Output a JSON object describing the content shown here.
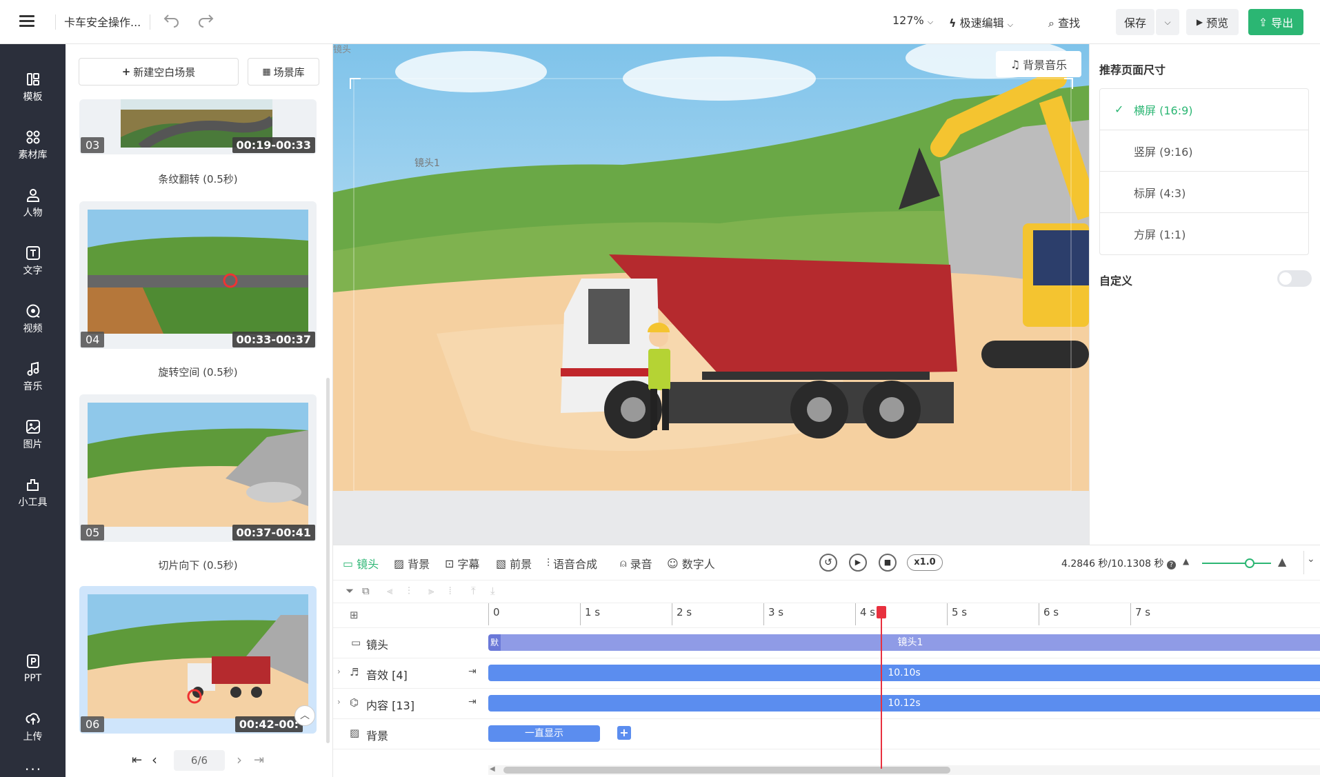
{
  "app": {
    "title": "卡车安全操作...",
    "zoom": "127%",
    "mode": "极速编辑",
    "find": "查找",
    "save": "保存",
    "preview": "预览",
    "export": "导出"
  },
  "nav": [
    {
      "label": "模板",
      "icon": "template-icon"
    },
    {
      "label": "素材库",
      "icon": "assets-icon"
    },
    {
      "label": "人物",
      "icon": "person-icon"
    },
    {
      "label": "文字",
      "icon": "text-icon"
    },
    {
      "label": "视频",
      "icon": "video-icon"
    },
    {
      "label": "音乐",
      "icon": "music-icon"
    },
    {
      "label": "图片",
      "icon": "image-icon"
    },
    {
      "label": "小工具",
      "icon": "tools-icon"
    },
    {
      "label": "PPT",
      "icon": "ppt-icon"
    },
    {
      "label": "上传",
      "icon": "upload-icon"
    }
  ],
  "scenes": {
    "new_blank": "新建空白场景",
    "library": "场景库",
    "items": [
      {
        "num": "03",
        "time": "00:19-00:33",
        "transition": "条纹翻转 (0.5秒)"
      },
      {
        "num": "04",
        "time": "00:33-00:37",
        "transition": "旋转空间 (0.5秒)"
      },
      {
        "num": "05",
        "time": "00:37-00:41",
        "transition": "切片向下 (0.5秒)"
      },
      {
        "num": "06",
        "time": "00:42-00:"
      }
    ],
    "page_indicator": "6/6"
  },
  "canvas": {
    "shot_tag": "镜头",
    "shot_label": "镜头1",
    "bg_music": "背景音乐"
  },
  "page_size": {
    "title": "推荐页面尺寸",
    "options": [
      "横屏 (16:9)",
      "竖屏 (9:16)",
      "标屏 (4:3)",
      "方屏 (1:1)"
    ],
    "selected": 0,
    "custom": "自定义"
  },
  "timeline": {
    "tools": [
      "镜头",
      "背景",
      "字幕",
      "前景",
      "语音合成",
      "录音",
      "数字人"
    ],
    "speed": "x1.0",
    "time_readout": "4.2846 秒/10.1308 秒",
    "ticks": [
      "0",
      "1 s",
      "2 s",
      "3 s",
      "4 s",
      "5 s",
      "6 s",
      "7 s"
    ],
    "tracks": [
      {
        "label": "镜头",
        "clip": "镜头1",
        "badge": "默"
      },
      {
        "label": "音效 [4]",
        "clip": "10.10s"
      },
      {
        "label": "内容 [13]",
        "clip": "10.12s"
      },
      {
        "label": "背景",
        "clip": "一直显示"
      }
    ],
    "playhead_seconds": 4.2846
  },
  "colors": {
    "accent_green": "#2bb673",
    "nav_bg": "#2b2f3b",
    "clip_blue": "#5b8def",
    "shot_purple": "#8f9be6",
    "playhead": "#e8303e"
  }
}
